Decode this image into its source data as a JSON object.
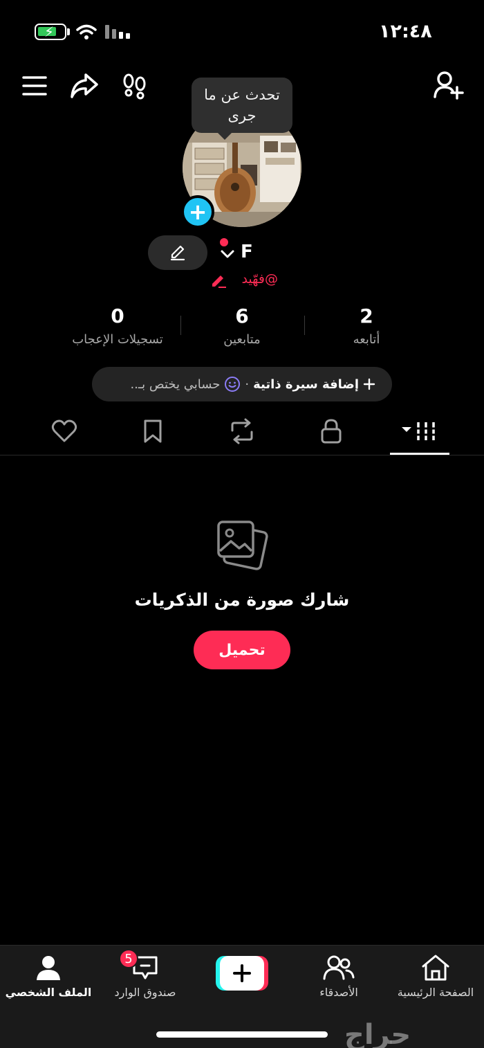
{
  "status_bar": {
    "time": "١٢:٤٨"
  },
  "tooltip": {
    "text": "تحدث عن ما جرى"
  },
  "profile": {
    "name": "F",
    "username": "@فهّيد"
  },
  "stats": [
    {
      "value": "2",
      "label": "أتابعه"
    },
    {
      "value": "6",
      "label": "متابعين"
    },
    {
      "value": "0",
      "label": "تسجيلات الإعجاب"
    }
  ],
  "bio": {
    "add_label": "إضافة سيرة ذاتية",
    "separator": "·",
    "hint": "حسابي يختص بـ.."
  },
  "tabs": [
    "videos-icon",
    "lock-icon",
    "repost-icon",
    "bookmark-icon",
    "heart-icon"
  ],
  "empty_state": {
    "title": "شارك صورة من الذكريات",
    "button": "تحميل"
  },
  "bottom_nav": {
    "home": "الصفحة الرئيسية",
    "friends": "الأصدقاء",
    "inbox": "صندوق الوارد",
    "inbox_badge": "5",
    "profile": "الملف الشخصي"
  },
  "watermark": "حراج",
  "colors": {
    "accent": "#fe2c55",
    "story_add": "#20c4f4",
    "battery": "#33c759"
  }
}
